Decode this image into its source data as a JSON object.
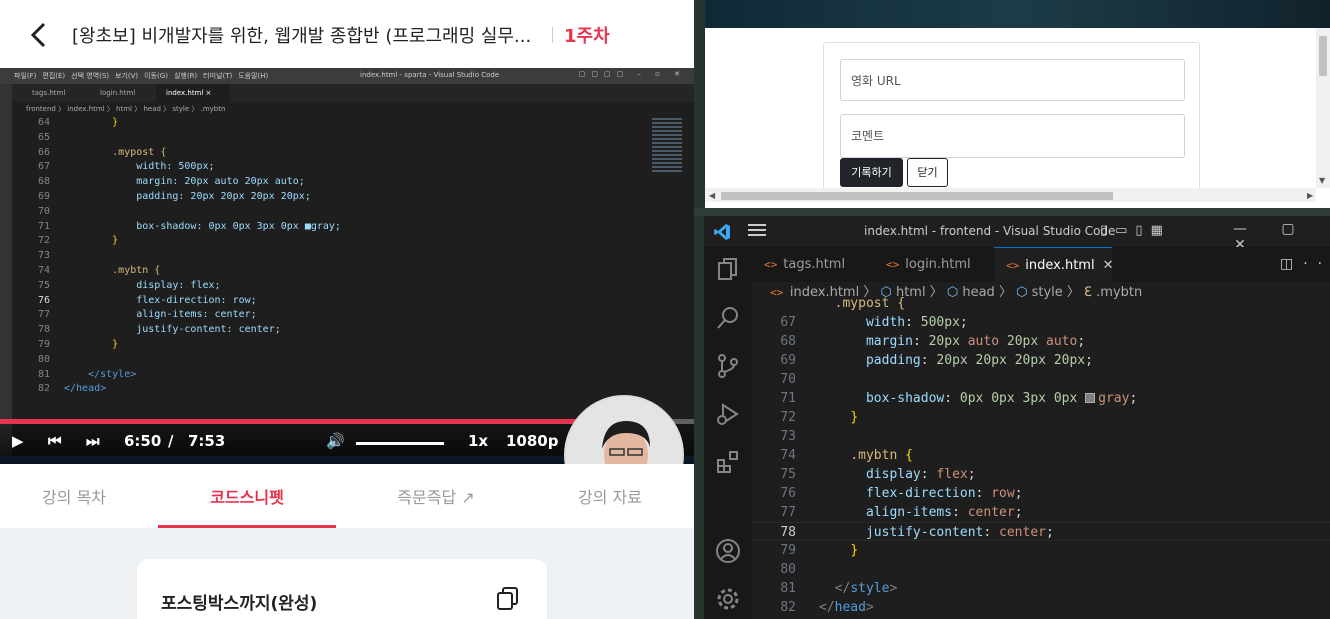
{
  "lecture": {
    "title": "[왕초보] 비개발자를 위한, 웹개발 종합반 (프로그래밍 실무...",
    "week": "1주차",
    "tabs": [
      {
        "label": "강의 목차",
        "active": false
      },
      {
        "label": "코드스니펫",
        "active": true
      },
      {
        "label": "즉문즉답",
        "active": false
      },
      {
        "label": "강의 자료",
        "active": false
      }
    ],
    "snippet_title": "포스팅박스까지(완성)"
  },
  "video": {
    "current_time": "6:50",
    "separator": "/",
    "duration": "7:53",
    "progress": 0.865,
    "speed": "1x",
    "quality": "1080p",
    "inner_window_title": "index.html - sparta - Visual Studio Code",
    "inner_menu": [
      "파일(F)",
      "편집(E)",
      "선택 영역(S)",
      "보기(V)",
      "이동(G)",
      "실행(R)",
      "터미널(T)",
      "도움말(H)"
    ],
    "inner_tabs": [
      "tags.html",
      "login.html",
      "index.html ×"
    ],
    "inner_breadcrumb": "frontend 〉 index.html 〉 html 〉 head 〉 style 〉 .mybtn",
    "inner_code": [
      {
        "n": "64",
        "t": "        }"
      },
      {
        "n": "65",
        "t": ""
      },
      {
        "n": "66",
        "t": "        .mypost {"
      },
      {
        "n": "67",
        "t": "            width: 500px;"
      },
      {
        "n": "68",
        "t": "            margin: 20px auto 20px auto;"
      },
      {
        "n": "69",
        "t": "            padding: 20px 20px 20px 20px;"
      },
      {
        "n": "70",
        "t": ""
      },
      {
        "n": "71",
        "t": "            box-shadow: 0px 0px 3px 0px ■gray;"
      },
      {
        "n": "72",
        "t": "        }"
      },
      {
        "n": "73",
        "t": ""
      },
      {
        "n": "74",
        "t": "        .mybtn {"
      },
      {
        "n": "75",
        "t": "            display: flex;"
      },
      {
        "n": "76",
        "t": "            flex-direction: row;"
      },
      {
        "n": "77",
        "t": "            align-items: center;"
      },
      {
        "n": "78",
        "t": "            justify-content: center;"
      },
      {
        "n": "79",
        "t": "        }"
      },
      {
        "n": "80",
        "t": ""
      },
      {
        "n": "81",
        "t": "    </style>"
      },
      {
        "n": "82",
        "t": "</head>"
      }
    ]
  },
  "browser": {
    "url_placeholder": "영화 URL",
    "comment_placeholder": "코멘트",
    "save_label": "기록하기",
    "close_label": "닫기"
  },
  "vscode": {
    "window_title": "index.html - frontend - Visual Studio Code",
    "tabs": [
      {
        "label": "tags.html",
        "active": false
      },
      {
        "label": "login.html",
        "active": false
      },
      {
        "label": "index.html",
        "active": true
      }
    ],
    "breadcrumb": [
      "index.html",
      "html",
      "head",
      "style",
      ".mybtn"
    ],
    "code_lines": [
      {
        "n": "67",
        "t": "width: 500px;"
      },
      {
        "n": "68",
        "t": "margin: 20px auto 20px auto;"
      },
      {
        "n": "69",
        "t": "padding: 20px 20px 20px 20px;"
      },
      {
        "n": "70",
        "t": ""
      },
      {
        "n": "71",
        "t": "box-shadow: 0px 0px 3px 0px gray;"
      },
      {
        "n": "72",
        "t": "}"
      },
      {
        "n": "73",
        "t": ""
      },
      {
        "n": "74",
        "t": ".mybtn {"
      },
      {
        "n": "75",
        "t": "display: flex;"
      },
      {
        "n": "76",
        "t": "flex-direction: row;"
      },
      {
        "n": "77",
        "t": "align-items: center;"
      },
      {
        "n": "78",
        "t": "justify-content: center;"
      },
      {
        "n": "79",
        "t": "}"
      },
      {
        "n": "80",
        "t": ""
      },
      {
        "n": "81",
        "t": "</style>"
      },
      {
        "n": "82",
        "t": "</head>"
      }
    ]
  },
  "colors": {
    "accent": "#e8344e",
    "vscode_bg": "#1e1e1e",
    "vscode_blue": "#0078d4"
  }
}
